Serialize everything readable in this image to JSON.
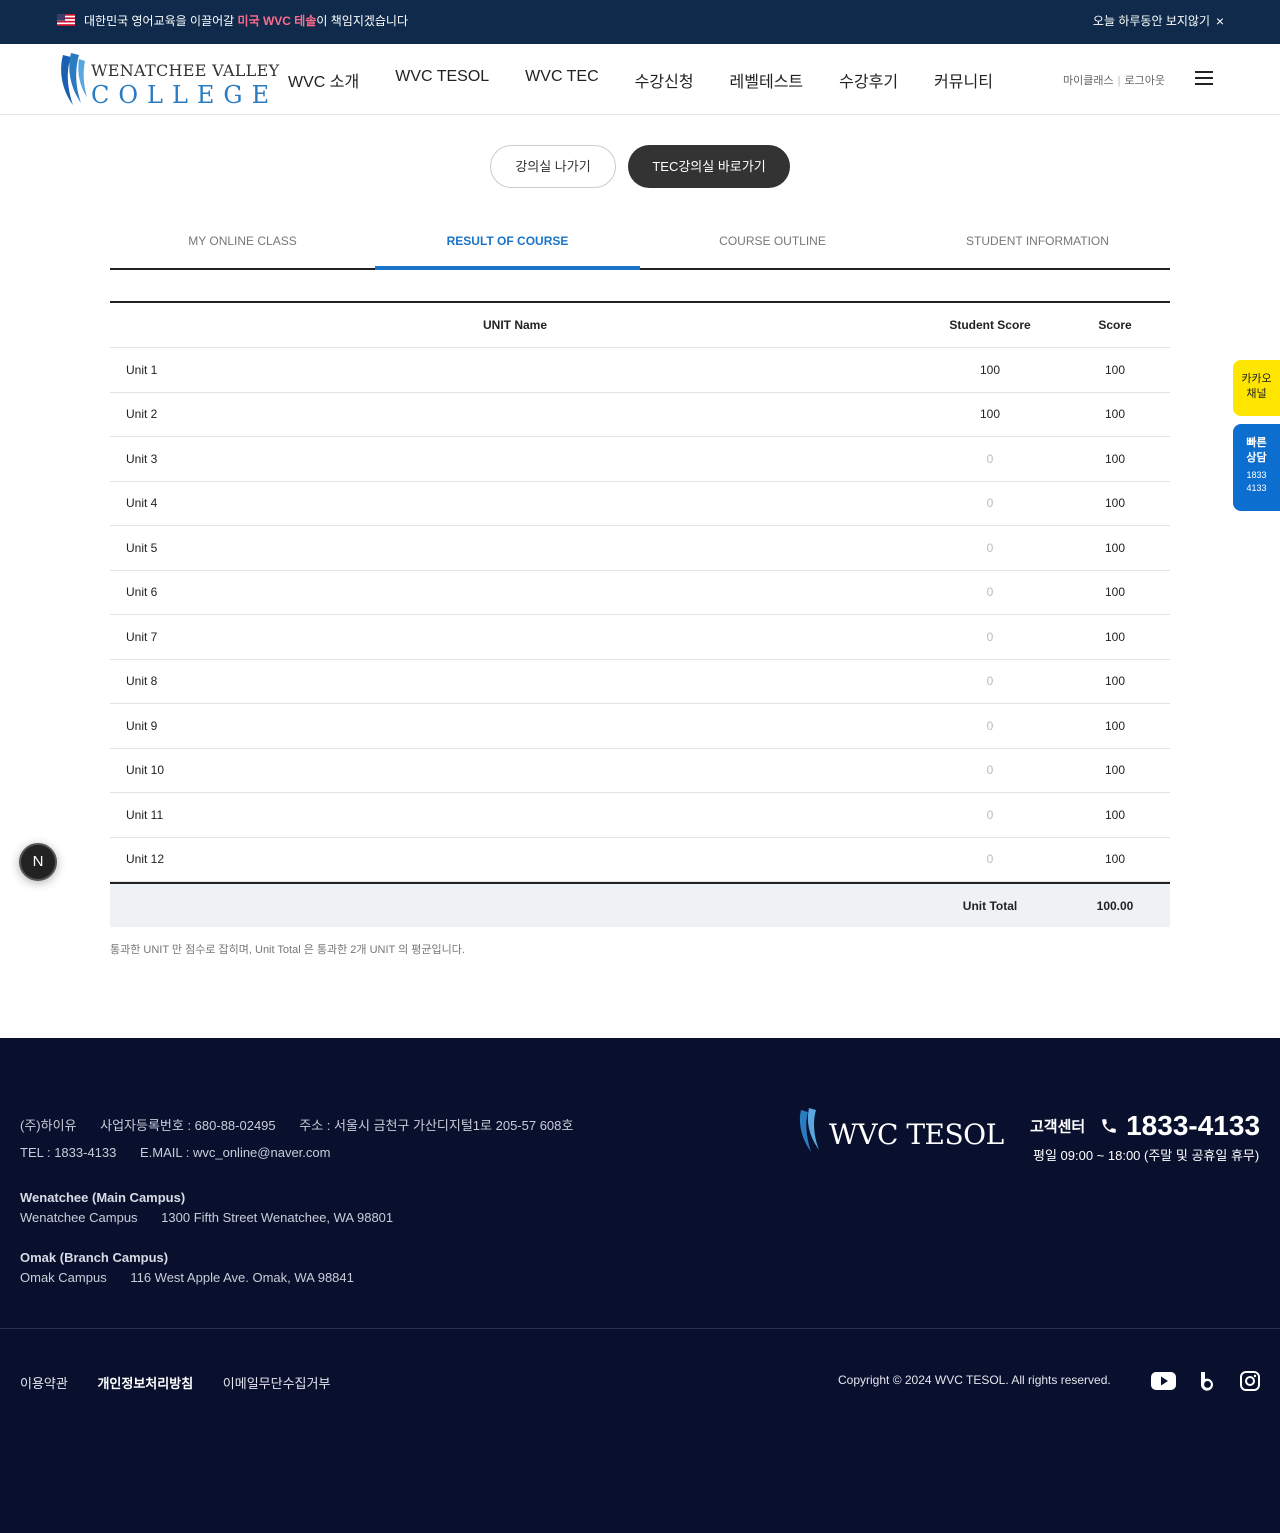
{
  "topbar": {
    "message_pre": "대한민국 영어교육을 이끌어갈 ",
    "message_highlight": "미국 WVC 테솔",
    "message_post": "이 책임지겠습니다",
    "close_today": "오늘 하루동안 보지않기",
    "close_symbol": "×",
    "flag_icon": "us-flag-icon"
  },
  "header": {
    "logo_line1": "WENATCHEE VALLEY",
    "logo_line2": "COLLEGE",
    "nav": [
      "WVC 소개",
      "WVC TESOL",
      "WVC TEC",
      "수강신청",
      "레벨테스트",
      "수강후기",
      "커뮤니티"
    ],
    "my_class": "마이클래스",
    "separator": "|",
    "logout": "로그아웃"
  },
  "actions": {
    "exit_label": "강의실 나가기",
    "tec_label": "TEC강의실 바로가기"
  },
  "tabs": [
    {
      "label": "MY ONLINE CLASS",
      "active": false
    },
    {
      "label": "RESULT OF COURSE",
      "active": true
    },
    {
      "label": "COURSE OUTLINE",
      "active": false
    },
    {
      "label": "STUDENT INFORMATION",
      "active": false
    }
  ],
  "table": {
    "headers": {
      "name": "UNIT Name",
      "student_score": "Student Score",
      "score": "Score"
    },
    "rows": [
      {
        "name": "Unit 1",
        "student_score": "100",
        "score": "100"
      },
      {
        "name": "Unit 2",
        "student_score": "100",
        "score": "100"
      },
      {
        "name": "Unit 3",
        "student_score": "0",
        "score": "100"
      },
      {
        "name": "Unit 4",
        "student_score": "0",
        "score": "100"
      },
      {
        "name": "Unit 5",
        "student_score": "0",
        "score": "100"
      },
      {
        "name": "Unit 6",
        "student_score": "0",
        "score": "100"
      },
      {
        "name": "Unit 7",
        "student_score": "0",
        "score": "100"
      },
      {
        "name": "Unit 8",
        "student_score": "0",
        "score": "100"
      },
      {
        "name": "Unit 9",
        "student_score": "0",
        "score": "100"
      },
      {
        "name": "Unit 10",
        "student_score": "0",
        "score": "100"
      },
      {
        "name": "Unit 11",
        "student_score": "0",
        "score": "100"
      },
      {
        "name": "Unit 12",
        "student_score": "0",
        "score": "100"
      }
    ],
    "total_label": "Unit Total",
    "total_value": "100.00"
  },
  "note": "통과한 UNIT 만 점수로 잡히며, Unit Total 은 통과한 2개 UNIT 의 평균입니다.",
  "side": {
    "kakao_line1": "카카오",
    "kakao_line2": "채널",
    "quick_line1": "빠른",
    "quick_line2": "상담",
    "quick_num1": "1833",
    "quick_num2": "4133",
    "n_badge": "N"
  },
  "footer": {
    "company": "(주)하이유",
    "biz_no": "사업자등록번호 : 680-88-02495",
    "address": "주소 : 서울시 금천구 가산디지털1로 205-57 608호",
    "tel": "TEL : 1833-4133",
    "email": "E.MAIL : wvc_online@naver.com",
    "main_campus_title": "Wenatchee (Main Campus)",
    "main_campus_name": "Wenatchee Campus",
    "main_campus_addr": "1300 Fifth Street Wenatchee, WA 98801",
    "branch_campus_title": "Omak (Branch Campus)",
    "branch_campus_name": "Omak Campus",
    "branch_campus_addr": "116 West Apple Ave. Omak, WA 98841",
    "logo_text": "WVC TESOL",
    "cs_label": "고객센터",
    "cs_phone": "1833-4133",
    "cs_hours": "평일 09:00 ~ 18:00 (주말 및 공휴일 휴무)",
    "links": [
      "이용약관",
      "개인정보처리방침",
      "이메일무단수집거부"
    ],
    "copyright": "Copyright © 2024 WVC TESOL. All rights reserved.",
    "social_icons": [
      "youtube-icon",
      "blog-icon",
      "instagram-icon"
    ]
  },
  "colors": {
    "topbar_bg": "#0f2a4a",
    "highlight": "#ff6b8a",
    "accent_blue": "#1b74c7",
    "footer_bg": "#08102d",
    "kakao_yellow": "#fee500",
    "quick_blue": "#0c6fcf"
  }
}
